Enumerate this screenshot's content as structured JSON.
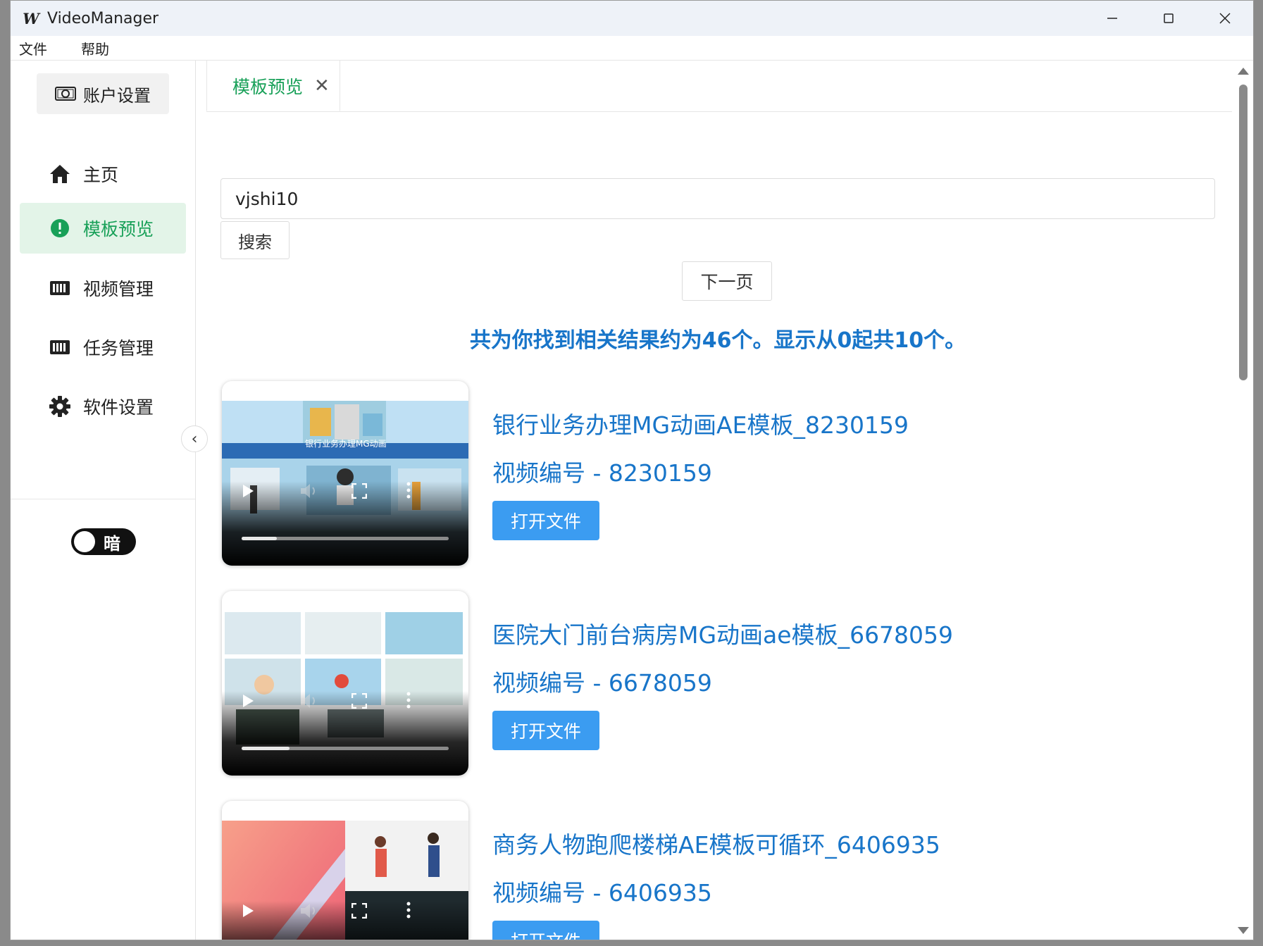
{
  "window": {
    "title": "VideoManager",
    "icon_letter": "W",
    "controls": {
      "minimize": "─",
      "maximize": "☐",
      "close": "✕"
    }
  },
  "menubar": [
    "文件",
    "帮助"
  ],
  "sidebar": {
    "account_button": "账户设置",
    "items": [
      {
        "label": "主页",
        "icon": "home-icon"
      },
      {
        "label": "模板预览",
        "icon": "alert-circle-icon",
        "active": true
      },
      {
        "label": "视频管理",
        "icon": "film-icon"
      },
      {
        "label": "任务管理",
        "icon": "film-icon"
      },
      {
        "label": "软件设置",
        "icon": "gear-icon"
      }
    ],
    "collapse_icon": "‹",
    "theme_toggle_label": "暗"
  },
  "tabs": [
    {
      "label": "模板预览",
      "close": "✕"
    }
  ],
  "search": {
    "value": "vjshi10",
    "button_label": "搜索"
  },
  "pagination": {
    "next_label": "下一页"
  },
  "results": {
    "summary": "共为你找到相关结果约为46个。显示从0起共10个。",
    "items": [
      {
        "title": "银行业务办理MG动画AE模板_8230159",
        "id_label": "视频编号 - 8230159",
        "button": "打开文件",
        "progress": 0.17,
        "thumb_caption": "银行业务办理MG动画"
      },
      {
        "title": "医院大门前台病房MG动画ae模板_6678059",
        "id_label": "视频编号 - 6678059",
        "button": "打开文件",
        "progress": 0.23
      },
      {
        "title": "商务人物跑爬楼梯AE模板可循环_6406935",
        "id_label": "视频编号 - 6406935",
        "button": "打开文件",
        "progress": 0.0
      }
    ]
  },
  "colors": {
    "accent_green": "#18a058",
    "link_blue": "#1875c9",
    "button_blue": "#3b9cf1"
  }
}
